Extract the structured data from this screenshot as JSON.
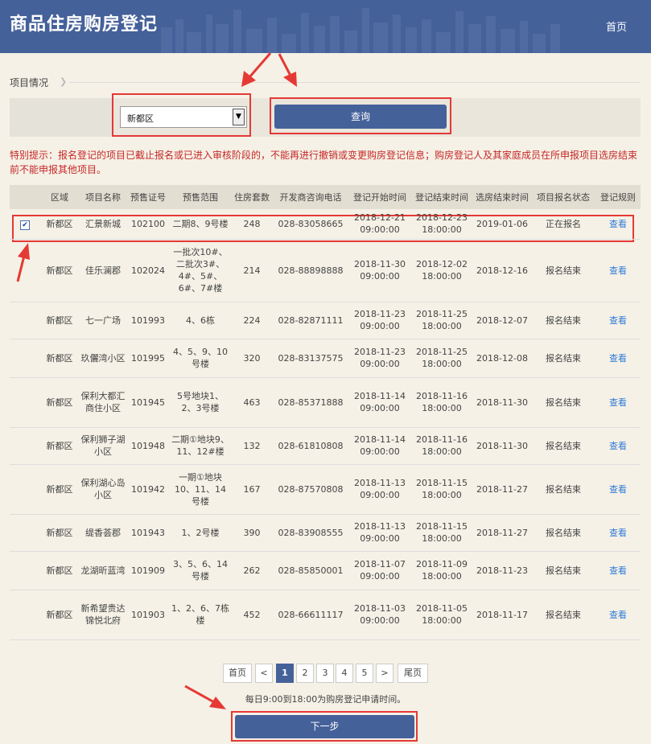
{
  "header": {
    "title": "商品住房购房登记",
    "home_link": "首页"
  },
  "section": {
    "label": "项目情况"
  },
  "filter": {
    "district_value": "新都区",
    "query_label": "查询"
  },
  "notice": "特别提示：报名登记的项目已截止报名或已进入审核阶段的，不能再进行撤销或变更购房登记信息；购房登记人及其家庭成员在所申报项目选房结束前不能申报其他项目。",
  "table": {
    "columns": [
      "区域",
      "项目名称",
      "预售证号",
      "预售范围",
      "住房套数",
      "开发商咨询电话",
      "登记开始时间",
      "登记结束时间",
      "选房结束时间",
      "项目报名状态",
      "登记规则"
    ],
    "rows": [
      {
        "checked": true,
        "district": "新都区",
        "project": "汇景新城",
        "permit": "102100",
        "scope": "二期8、9号楼",
        "units": "248",
        "phone": "028-83058665",
        "reg_start": "2018-12-21 09:00:00",
        "reg_end": "2018-12-23 18:00:00",
        "select_end": "2019-01-06",
        "status": "正在报名",
        "rule": "查看"
      },
      {
        "checked": false,
        "district": "新都区",
        "project": "佳乐澜郡",
        "permit": "102024",
        "scope": "一批次10#、二批次3#、4#、5#、6#、7#楼",
        "units": "214",
        "phone": "028-88898888",
        "reg_start": "2018-11-30 09:00:00",
        "reg_end": "2018-12-02 18:00:00",
        "select_end": "2018-12-16",
        "status": "报名结束",
        "rule": "查看"
      },
      {
        "checked": false,
        "district": "新都区",
        "project": "七一广场",
        "permit": "101993",
        "scope": "4、6栋",
        "units": "224",
        "phone": "028-82871111",
        "reg_start": "2018-11-23 09:00:00",
        "reg_end": "2018-11-25 18:00:00",
        "select_end": "2018-12-07",
        "status": "报名结束",
        "rule": "查看"
      },
      {
        "checked": false,
        "district": "新都区",
        "project": "玖儷湾小区",
        "permit": "101995",
        "scope": "4、5、9、10号楼",
        "units": "320",
        "phone": "028-83137575",
        "reg_start": "2018-11-23 09:00:00",
        "reg_end": "2018-11-25 18:00:00",
        "select_end": "2018-12-08",
        "status": "报名结束",
        "rule": "查看"
      },
      {
        "checked": false,
        "district": "新都区",
        "project": "保利大都汇商住小区",
        "permit": "101945",
        "scope": "5号地块1、2、3号楼",
        "units": "463",
        "phone": "028-85371888",
        "reg_start": "2018-11-14 09:00:00",
        "reg_end": "2018-11-16 18:00:00",
        "select_end": "2018-11-30",
        "status": "报名结束",
        "rule": "查看"
      },
      {
        "checked": false,
        "district": "新都区",
        "project": "保利狮子湖小区",
        "permit": "101948",
        "scope": "二期①地块9、11、12#楼",
        "units": "132",
        "phone": "028-61810808",
        "reg_start": "2018-11-14 09:00:00",
        "reg_end": "2018-11-16 18:00:00",
        "select_end": "2018-11-30",
        "status": "报名结束",
        "rule": "查看"
      },
      {
        "checked": false,
        "district": "新都区",
        "project": "保利湖心岛小区",
        "permit": "101942",
        "scope": "一期①地块10、11、14号楼",
        "units": "167",
        "phone": "028-87570808",
        "reg_start": "2018-11-13 09:00:00",
        "reg_end": "2018-11-15 18:00:00",
        "select_end": "2018-11-27",
        "status": "报名结束",
        "rule": "查看"
      },
      {
        "checked": false,
        "district": "新都区",
        "project": "缇香荟郡",
        "permit": "101943",
        "scope": "1、2号楼",
        "units": "390",
        "phone": "028-83908555",
        "reg_start": "2018-11-13 09:00:00",
        "reg_end": "2018-11-15 18:00:00",
        "select_end": "2018-11-27",
        "status": "报名结束",
        "rule": "查看"
      },
      {
        "checked": false,
        "district": "新都区",
        "project": "龙湖昕蓝湾",
        "permit": "101909",
        "scope": "3、5、6、14号楼",
        "units": "262",
        "phone": "028-85850001",
        "reg_start": "2018-11-07 09:00:00",
        "reg_end": "2018-11-09 18:00:00",
        "select_end": "2018-11-23",
        "status": "报名结束",
        "rule": "查看"
      },
      {
        "checked": false,
        "district": "新都区",
        "project": "新希望贵达锦悦北府",
        "permit": "101903",
        "scope": "1、2、6、7栋楼",
        "units": "452",
        "phone": "028-66611117",
        "reg_start": "2018-11-03 09:00:00",
        "reg_end": "2018-11-05 18:00:00",
        "select_end": "2018-11-17",
        "status": "报名结束",
        "rule": "查看"
      }
    ]
  },
  "pagination": {
    "first": "首页",
    "prev": "<",
    "pages": [
      "1",
      "2",
      "3",
      "4",
      "5"
    ],
    "current": "1",
    "next": ">",
    "last": "尾页"
  },
  "footer": {
    "note": "每日9:00到18:00为购房登记申请时间。",
    "next_label": "下一步"
  },
  "colors": {
    "brand": "#45619a",
    "annotation_red": "#e53935",
    "notice_red": "#c62828",
    "link_blue": "#2f7bd8"
  }
}
